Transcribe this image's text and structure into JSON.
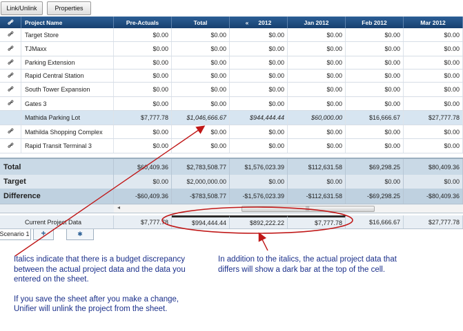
{
  "toolbar": {
    "link_unlink_label": "Link/Unlink",
    "properties_label": "Properties"
  },
  "header": {
    "project_name": "Project Name",
    "pre_actuals": "Pre-Actuals",
    "total": "Total",
    "y2012": "2012",
    "jan_2012": "Jan 2012",
    "feb_2012": "Feb 2012",
    "mar_2012": "Mar 2012"
  },
  "rows": [
    {
      "name": "Target Store",
      "linked": true,
      "values": [
        "$0.00",
        "$0.00",
        "$0.00",
        "$0.00",
        "$0.00",
        "$0.00"
      ]
    },
    {
      "name": "TJMaxx",
      "linked": true,
      "values": [
        "$0.00",
        "$0.00",
        "$0.00",
        "$0.00",
        "$0.00",
        "$0.00"
      ]
    },
    {
      "name": "Parking Extension",
      "linked": true,
      "values": [
        "$0.00",
        "$0.00",
        "$0.00",
        "$0.00",
        "$0.00",
        "$0.00"
      ]
    },
    {
      "name": "Rapid Central Station",
      "linked": true,
      "values": [
        "$0.00",
        "$0.00",
        "$0.00",
        "$0.00",
        "$0.00",
        "$0.00"
      ]
    },
    {
      "name": "South Tower Expansion",
      "linked": true,
      "values": [
        "$0.00",
        "$0.00",
        "$0.00",
        "$0.00",
        "$0.00",
        "$0.00"
      ]
    },
    {
      "name": "Gates 3",
      "linked": true,
      "values": [
        "$0.00",
        "$0.00",
        "$0.00",
        "$0.00",
        "$0.00",
        "$0.00"
      ]
    },
    {
      "name": "Mathida Parking Lot",
      "linked": false,
      "values": [
        "$7,777.78",
        "$1,046,666.67",
        "$944,444.44",
        "$60,000.00",
        "$16,666.67",
        "$27,777.78"
      ]
    },
    {
      "name": "Mathilda Shopping Complex",
      "linked": true,
      "values": [
        "$0.00",
        "$0.00",
        "$0.00",
        "$0.00",
        "$0.00",
        "$0.00"
      ]
    },
    {
      "name": "Rapid Transit Terminal 3",
      "linked": true,
      "values": [
        "$0.00",
        "$0.00",
        "$0.00",
        "$0.00",
        "$0.00",
        "$0.00"
      ]
    }
  ],
  "summary": {
    "total": {
      "label": "Total",
      "values": [
        "$60,409.36",
        "$2,783,508.77",
        "$1,576,023.39",
        "$112,631.58",
        "$69,298.25",
        "$80,409.36"
      ]
    },
    "target": {
      "label": "Target",
      "values": [
        "$0.00",
        "$2,000,000.00",
        "$0.00",
        "$0.00",
        "$0.00",
        "$0.00"
      ]
    },
    "difference": {
      "label": "Difference",
      "values": [
        "-$60,409.36",
        "-$783,508.77",
        "-$1,576,023.39",
        "-$112,631.58",
        "-$69,298.25",
        "-$80,409.36"
      ]
    }
  },
  "current_project": {
    "label": "Current Project Data",
    "values": [
      "$7,777.78",
      "$994,444.44",
      "$892,222.22",
      "$7,777.78",
      "$16,666.67",
      "$27,777.78"
    ]
  },
  "tabs": {
    "scenario": "Scenario 1",
    "add": "+",
    "gear": "✱"
  },
  "annotations": {
    "left_p1": "Italics indicate that there is a budget discrepancy between the actual project data and the data you entered on the sheet.",
    "left_p2": "If you save the sheet after you make a change, Unifier will unlink the project from the sheet.",
    "right_p1": "In addition to the italics, the actual project data that differs will show a dark bar at the top of the cell."
  },
  "icons": {
    "link": "link-icon",
    "collapse": "double-chevron-left-icon",
    "settings": "gear-icon"
  },
  "colors": {
    "header_bg": "#1e4d80",
    "selected_row": "#d7e5f1",
    "annotation_red": "#c01818",
    "annotation_text": "#1a2f8a"
  }
}
